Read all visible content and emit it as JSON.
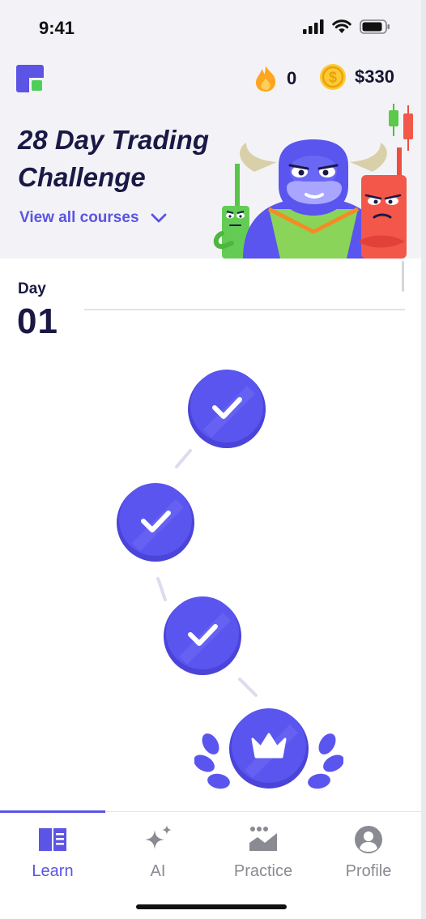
{
  "status_bar": {
    "time": "9:41"
  },
  "header": {
    "streak_count": "0",
    "coins": "$330",
    "course_title": "28 Day Trading Challenge",
    "view_all_label": "View all courses"
  },
  "day": {
    "label": "Day",
    "number": "01"
  },
  "lessons": [
    {
      "state": "completed"
    },
    {
      "state": "completed"
    },
    {
      "state": "completed"
    },
    {
      "state": "crown-milestone"
    }
  ],
  "tabs": [
    {
      "label": "Learn",
      "icon": "book-icon",
      "active": true
    },
    {
      "label": "AI",
      "icon": "sparkle-icon",
      "active": false
    },
    {
      "label": "Practice",
      "icon": "chart-mountain-icon",
      "active": false
    },
    {
      "label": "Profile",
      "icon": "person-icon",
      "active": false
    }
  ],
  "colors": {
    "accent": "#5b54e4",
    "node": "#5a55ee",
    "header_bg": "#f3f3f7",
    "title": "#1a1845",
    "inactive": "#8a8a93"
  }
}
